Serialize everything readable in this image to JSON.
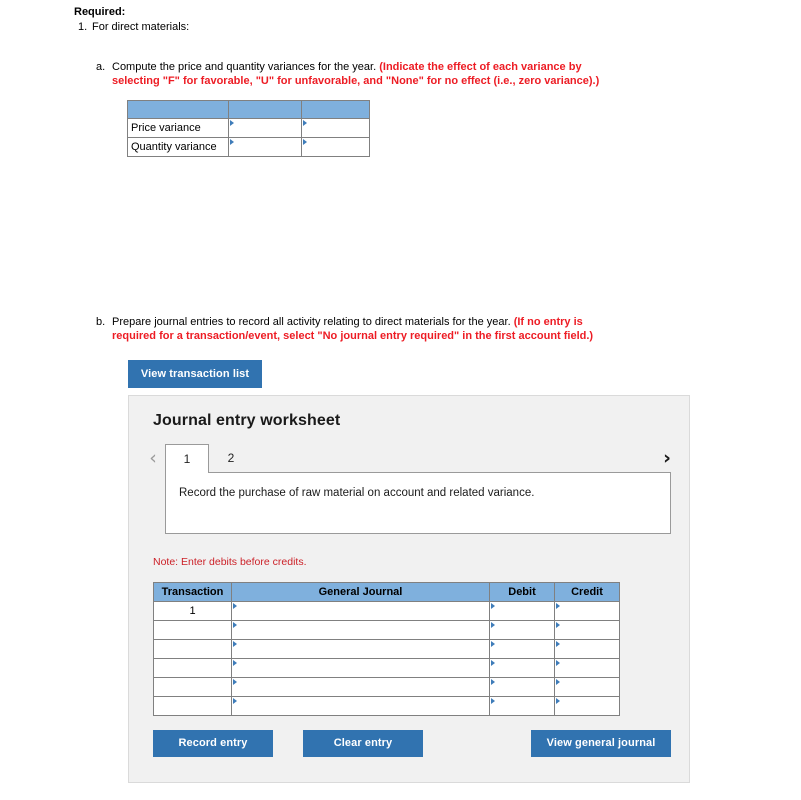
{
  "required": {
    "title": "Required:",
    "item_number": "1.",
    "item_text": "For direct materials:"
  },
  "part_a": {
    "letter": "a.",
    "text": "Compute the price and quantity variances for the year. ",
    "emphasis": "(Indicate the effect of each variance by selecting \"F\" for favorable, \"U\" for unfavorable, and \"None\" for no effect (i.e., zero variance).)"
  },
  "variance_table": {
    "headers": [
      "",
      "",
      ""
    ],
    "rows": [
      {
        "label": "Price variance",
        "amount": "",
        "effect": ""
      },
      {
        "label": "Quantity variance",
        "amount": "",
        "effect": ""
      }
    ]
  },
  "part_b": {
    "letter": "b.",
    "text": "Prepare journal entries to record all activity relating to direct materials for the year. ",
    "emphasis": "(If no entry is required for a transaction/event, select \"No journal entry required\" in the first account field.)"
  },
  "view_transaction_button": "View transaction list",
  "worksheet": {
    "title": "Journal entry worksheet",
    "prev_icon": "chevron-left-icon",
    "next_icon": "chevron-right-icon",
    "tabs": [
      {
        "label": "1",
        "active": true
      },
      {
        "label": "2",
        "active": false
      }
    ],
    "description": "Record the purchase of raw material on account and related variance.",
    "note": "Note: Enter debits before credits.",
    "journal": {
      "headers": [
        "Transaction",
        "General Journal",
        "Debit",
        "Credit"
      ],
      "rows": [
        {
          "transaction": "1",
          "general_journal": "",
          "debit": "",
          "credit": ""
        },
        {
          "transaction": "",
          "general_journal": "",
          "debit": "",
          "credit": ""
        },
        {
          "transaction": "",
          "general_journal": "",
          "debit": "",
          "credit": ""
        },
        {
          "transaction": "",
          "general_journal": "",
          "debit": "",
          "credit": ""
        },
        {
          "transaction": "",
          "general_journal": "",
          "debit": "",
          "credit": ""
        },
        {
          "transaction": "",
          "general_journal": "",
          "debit": "",
          "credit": ""
        }
      ]
    },
    "buttons": {
      "record": "Record entry",
      "clear": "Clear entry",
      "view_general_journal": "View general journal"
    }
  },
  "colors": {
    "button_blue": "#3173B0",
    "table_header_blue": "#7FB0DD",
    "emphasis_red": "#ED1C24",
    "note_red": "#CC2128",
    "panel_bg": "#F1F1F1"
  }
}
